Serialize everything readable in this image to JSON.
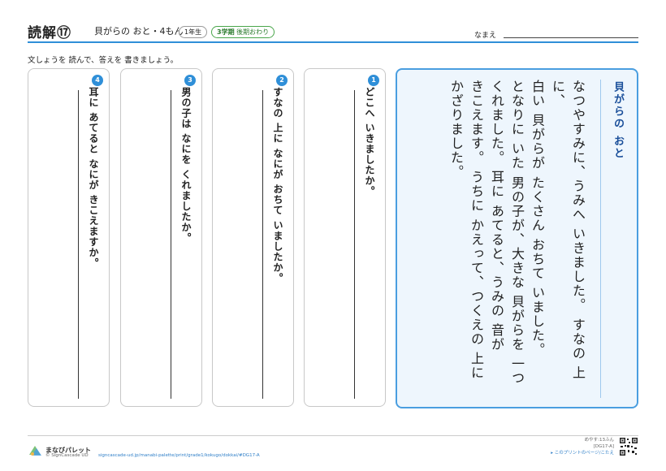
{
  "header": {
    "title": "読解⑰",
    "subtitle": "貝がらの おと・4もん",
    "grade": "1年生",
    "term_main": "3学期",
    "term_sub": "後期おわり",
    "name_label": "なまえ"
  },
  "instruction": "文しょうを 読んで、答えを 書きましょう。",
  "story": {
    "title": "貝がらの おと",
    "lines": [
      "なつやすみに、うみへ いきました。 すなの 上に、",
      "白い 貝がらが たくさん おちて いました。",
      "となりに いた 男の子が、大きな 貝がらを 一つ",
      "くれました。 耳に あてると、うみの 音が",
      "きこえます。 うちに かえって、つくえの 上に",
      "かざりました。"
    ]
  },
  "questions": [
    {
      "number": "1",
      "text": "どこへ いきましたか。"
    },
    {
      "number": "2",
      "text": "すなの 上に なにが おちて いましたか。"
    },
    {
      "number": "3",
      "text": "男の子は なにを くれましたか。"
    },
    {
      "number": "4",
      "text": "耳に あてると なにが きこえますか。"
    }
  ],
  "footer": {
    "brand": "まなびパレット",
    "copyright": "© SignCascade UD",
    "url": "signcascade-ud.jp/manabi-palette/print/grade1/kokugo/dokkai/#DG17-A",
    "time": "めやす:13ふん",
    "code": "[DG17-A]",
    "answer_link": "▸ このプリントのページ/こたえ"
  },
  "colors": {
    "accent": "#2f8fd8",
    "story_bg": "#eef6fd",
    "term": "#49a64a"
  }
}
